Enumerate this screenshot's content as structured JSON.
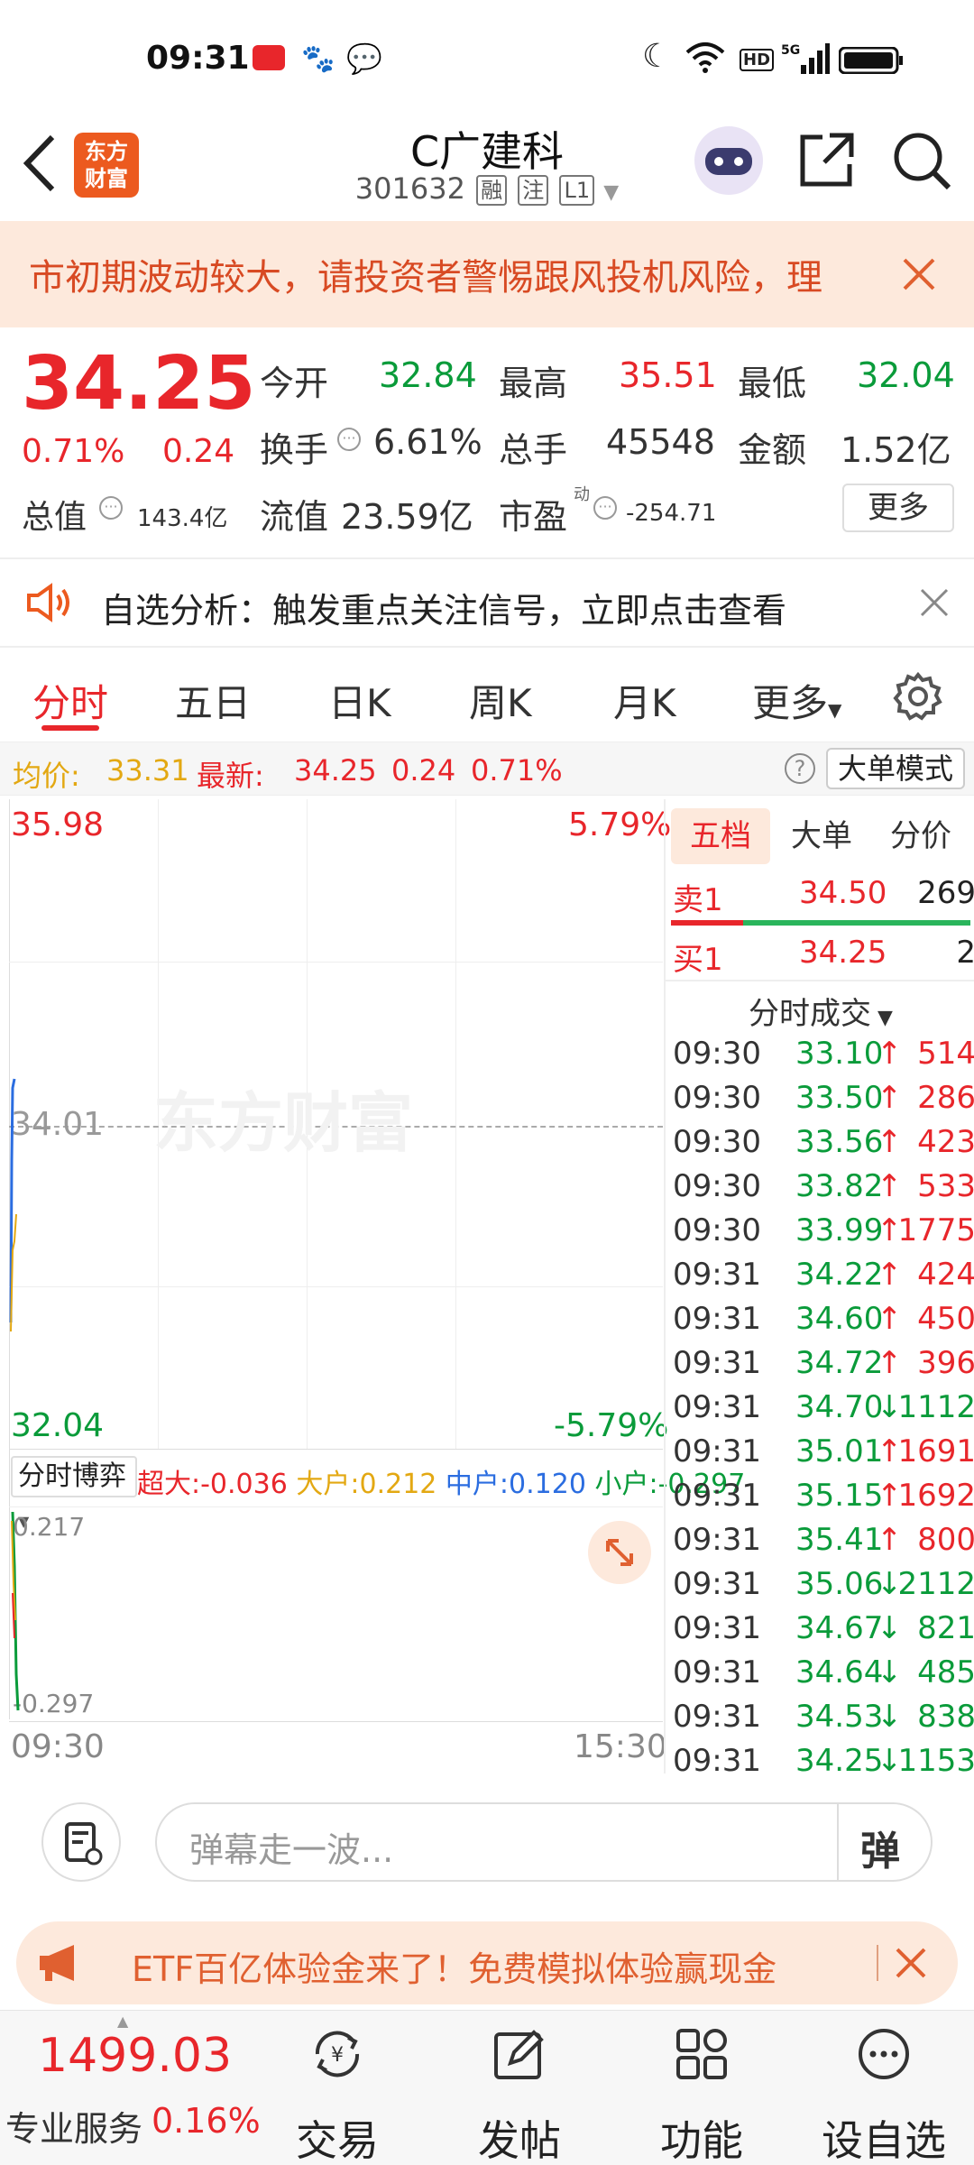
{
  "status_bar": {
    "time": "09:31"
  },
  "header": {
    "logo_text_line1": "东方",
    "logo_text_line2": "财富",
    "stock_name": "C广建科",
    "stock_code": "301632",
    "tags": [
      "融",
      "注",
      "L1"
    ]
  },
  "warning_banner": {
    "text": "市初期波动较大，请投资者警惕跟风投机风险，理"
  },
  "quote": {
    "price": "34.25",
    "change_pct": "0.71%",
    "change_amt": "0.24",
    "open_label": "今开",
    "open": "32.84",
    "high_label": "最高",
    "high": "35.51",
    "low_label": "最低",
    "low": "32.04",
    "turnover_label": "换手",
    "turnover": "6.61%",
    "volume_label": "总手",
    "volume": "45548",
    "amount_label": "金额",
    "amount": "1.52亿",
    "mktcap_label": "总值",
    "mktcap": "143.4亿",
    "float_label": "流值",
    "float": "23.59亿",
    "pe_label": "市盈",
    "pe_sup": "动",
    "pe": "-254.71",
    "more_button": "更多"
  },
  "notice": {
    "text": "自选分析：触发重点关注信号，立即点击查看"
  },
  "tabs": [
    "分时",
    "五日",
    "日K",
    "周K",
    "月K",
    "更多"
  ],
  "info_row": {
    "avg_label": "均价:",
    "avg": "33.31",
    "latest_label": "最新:",
    "latest": "34.25",
    "latest_chg": "0.24",
    "latest_pct": "0.71%",
    "mode_button": "大单模式"
  },
  "chart": {
    "y_top": "35.98",
    "y_top_pct": "5.79%",
    "y_mid": "34.01",
    "y_bottom": "32.04",
    "y_bottom_pct": "-5.79%",
    "watermark": "东方财富",
    "x_start": "09:30",
    "x_end": "15:30"
  },
  "flow": {
    "selector": "分时博弈",
    "super_label": "超大:",
    "super": "-0.036",
    "big_label": "大户:",
    "big": "0.212",
    "mid_label": "中户:",
    "mid": "0.120",
    "small_label": "小户:",
    "small": "-0.297",
    "y_top": "0.217",
    "y_bottom": "-0.297"
  },
  "right_panel": {
    "tabs": [
      "五档",
      "大单",
      "分价"
    ],
    "sell1_label": "卖1",
    "sell1_price": "34.50",
    "sell1_vol": "269",
    "buy1_label": "买1",
    "buy1_price": "34.25",
    "buy1_vol": "2",
    "ticks_title": "分时成交",
    "ticks": [
      {
        "t": "09:30",
        "p": "33.10",
        "dir": "up",
        "v": "514"
      },
      {
        "t": "09:30",
        "p": "33.50",
        "dir": "up",
        "v": "286"
      },
      {
        "t": "09:30",
        "p": "33.56",
        "dir": "up",
        "v": "423"
      },
      {
        "t": "09:30",
        "p": "33.82",
        "dir": "up",
        "v": "533"
      },
      {
        "t": "09:30",
        "p": "33.99",
        "dir": "up",
        "v": "1775"
      },
      {
        "t": "09:31",
        "p": "34.22",
        "dir": "up",
        "v": "424"
      },
      {
        "t": "09:31",
        "p": "34.60",
        "dir": "up",
        "v": "450"
      },
      {
        "t": "09:31",
        "p": "34.72",
        "dir": "up",
        "v": "396"
      },
      {
        "t": "09:31",
        "p": "34.70",
        "dir": "down",
        "v": "1112"
      },
      {
        "t": "09:31",
        "p": "35.01",
        "dir": "up",
        "v": "1691"
      },
      {
        "t": "09:31",
        "p": "35.15",
        "dir": "up",
        "v": "1692"
      },
      {
        "t": "09:31",
        "p": "35.41",
        "dir": "up",
        "v": "800"
      },
      {
        "t": "09:31",
        "p": "35.06",
        "dir": "down",
        "v": "2112"
      },
      {
        "t": "09:31",
        "p": "34.67",
        "dir": "down",
        "v": "821"
      },
      {
        "t": "09:31",
        "p": "34.64",
        "dir": "down",
        "v": "485"
      },
      {
        "t": "09:31",
        "p": "34.53",
        "dir": "down",
        "v": "838"
      },
      {
        "t": "09:31",
        "p": "34.25",
        "dir": "down",
        "v": "1153"
      }
    ]
  },
  "comment_bar": {
    "placeholder": "弹幕走一波...",
    "danmu_button": "弹"
  },
  "ad_banner": {
    "text": "ETF百亿体验金来了！免费模拟体验赢现金"
  },
  "bottom_nav": {
    "index_value": "1499.03",
    "index_label": "专业服务",
    "index_pct": "0.16%",
    "items": [
      "交易",
      "发帖",
      "功能",
      "设自选"
    ]
  },
  "colors": {
    "up": "#e8262b",
    "down": "#0a9b3a",
    "accent": "#ec5a1f"
  }
}
